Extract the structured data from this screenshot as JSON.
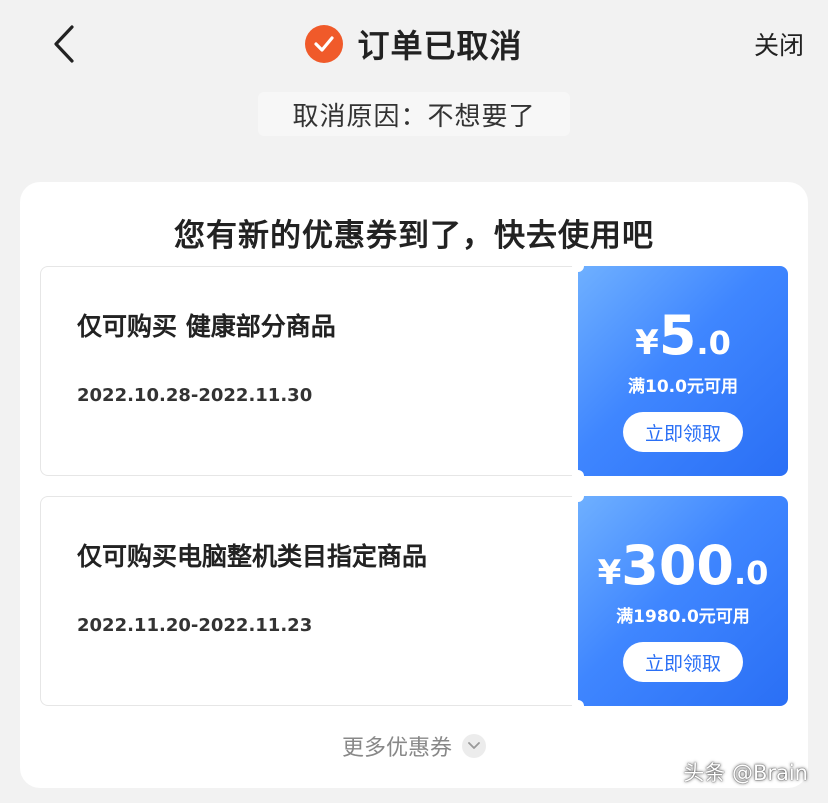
{
  "header": {
    "back_icon": "chevron-left-icon",
    "status_icon": "check-circle-icon",
    "status_color": "#f05a2a",
    "title": "订单已取消",
    "close_label": "关闭"
  },
  "reason": {
    "text": "取消原因：不想要了"
  },
  "coupon_panel": {
    "title": "您有新的优惠券到了，快去使用吧",
    "accent_color": "#3f86ff",
    "coupons": [
      {
        "desc": "仅可购买     健康部分商品",
        "date_range": "2022.10.28-2022.11.30",
        "currency": "¥",
        "amount_int": "5",
        "amount_dec": ".0",
        "condition": "满10.0元可用",
        "claim_label": "立即领取"
      },
      {
        "desc": "仅可购买电脑整机类目指定商品",
        "date_range": "2022.11.20-2022.11.23",
        "currency": "¥",
        "amount_int": "300",
        "amount_dec": ".0",
        "condition": "满1980.0元可用",
        "claim_label": "立即领取"
      }
    ],
    "more_label": "更多优惠券",
    "more_icon": "chevron-down-icon"
  },
  "watermark": {
    "text": "头条 @Brain"
  }
}
